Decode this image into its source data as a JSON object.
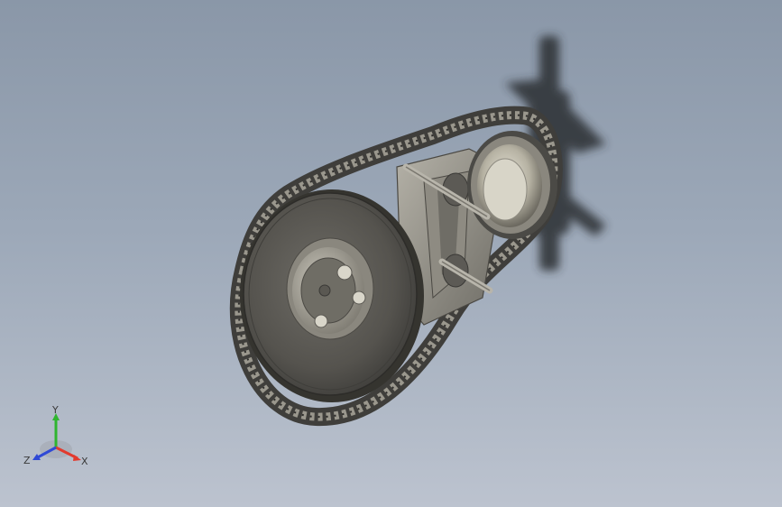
{
  "view": {
    "background_top": "#8a97a8",
    "background_bottom": "#bcc3cf"
  },
  "model": {
    "parts": [
      "timing-chain",
      "large-sprocket",
      "cam-hub",
      "bolt-holes",
      "tensioner-bracket",
      "small-sprocket-bearing",
      "guide-pins"
    ],
    "metal_color": "#7d7a72",
    "chain_color": "#4a4946"
  },
  "triad": {
    "x_label": "X",
    "y_label": "Y",
    "z_label": "Z",
    "x_color": "#e23a2e",
    "y_color": "#2fb52f",
    "z_color": "#2f49d6"
  }
}
